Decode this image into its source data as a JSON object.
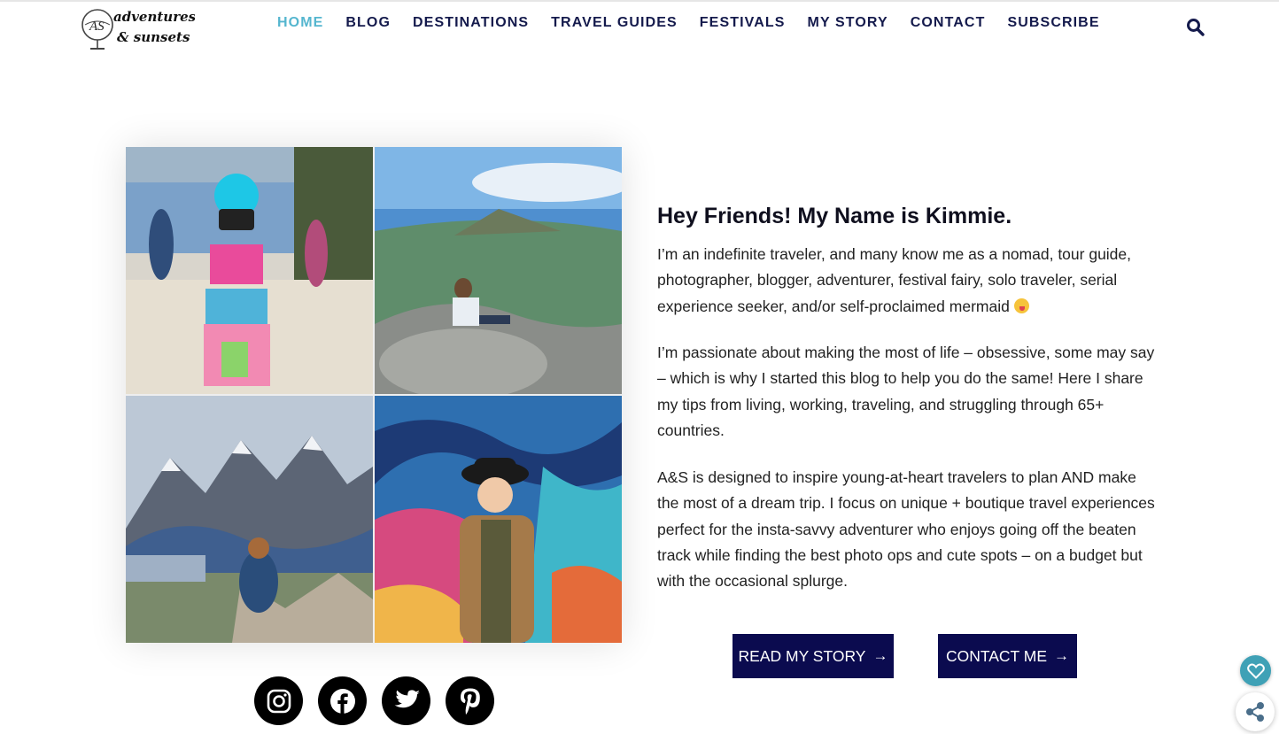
{
  "header": {
    "logo_text": "adventures & sunsets",
    "nav": [
      {
        "label": "HOME",
        "active": true
      },
      {
        "label": "BLOG",
        "active": false
      },
      {
        "label": "DESTINATIONS",
        "active": false
      },
      {
        "label": "TRAVEL GUIDES",
        "active": false
      },
      {
        "label": "FESTIVALS",
        "active": false
      },
      {
        "label": "MY STORY",
        "active": false
      },
      {
        "label": "CONTACT",
        "active": false
      },
      {
        "label": "SUBSCRIBE",
        "active": false
      }
    ],
    "search_icon": "search-icon"
  },
  "intro": {
    "heading": "Hey Friends! My Name is Kimmie.",
    "p1": "I’m an indefinite traveler, and many know me as a nomad, tour guide, photographer, blogger, adventurer, festival fairy, solo traveler, serial experience seeker, and/or self-proclaimed mermaid",
    "p2": "I’m passionate about making the most of life – obsessive, some may say – which is why I started this blog to help you do the same! Here I share my tips from living, working, traveling, and struggling through 65+ countries.",
    "p3": "A&S is designed to inspire young-at-heart travelers to plan AND make the most of a dream trip. I focus on unique + boutique travel experiences perfect for the insta-savvy adventurer who enjoys going off the beaten track while finding the best photo ops and cute spots – on a budget but with the occasional splurge.",
    "buttons": {
      "read_story": "READ MY STORY",
      "contact": "CONTACT ME",
      "arrow": "→"
    }
  },
  "social": [
    "instagram-icon",
    "facebook-icon",
    "twitter-icon",
    "pinterest-icon"
  ],
  "colors": {
    "nav_text": "#141a4c",
    "nav_active": "#55b6cf",
    "button_bg": "#0b0b4f",
    "fav_bg": "#3fa1b6"
  }
}
